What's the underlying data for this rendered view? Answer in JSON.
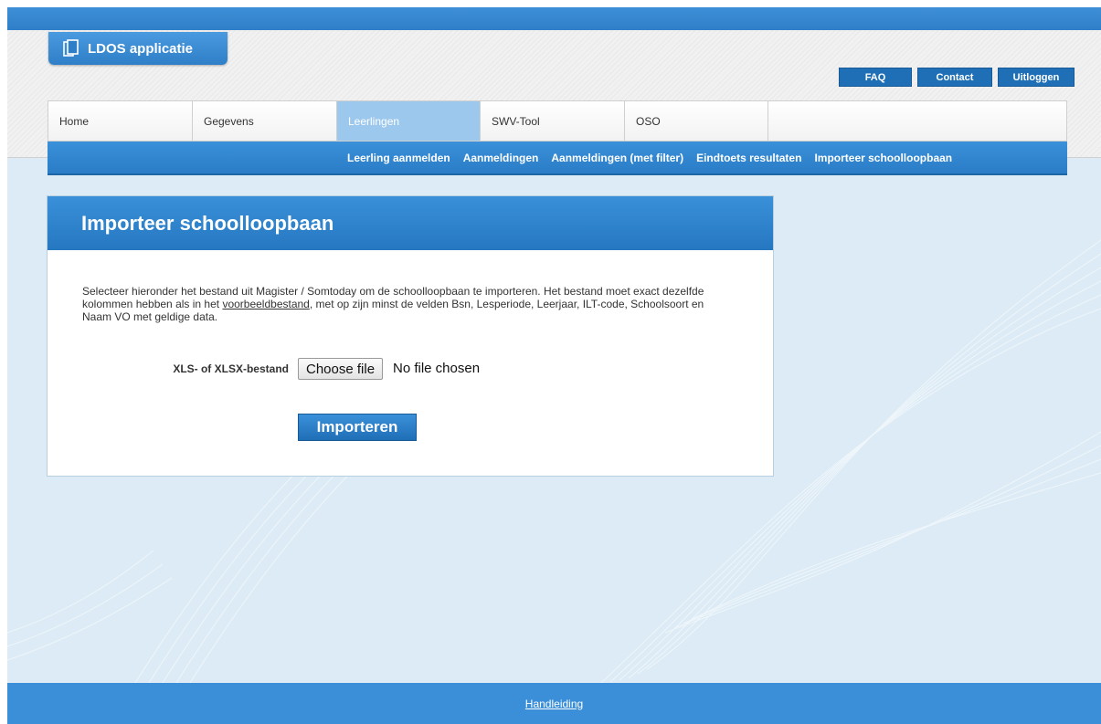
{
  "app": {
    "title": "LDOS applicatie"
  },
  "top_links": {
    "faq": "FAQ",
    "contact": "Contact",
    "logout": "Uitloggen"
  },
  "nav": {
    "tabs": [
      {
        "label": "Home"
      },
      {
        "label": "Gegevens"
      },
      {
        "label": "Leerlingen",
        "active": true
      },
      {
        "label": "SWV-Tool"
      },
      {
        "label": "OSO"
      }
    ]
  },
  "subnav": {
    "items": [
      {
        "label": "Leerling aanmelden"
      },
      {
        "label": "Aanmeldingen"
      },
      {
        "label": "Aanmeldingen (met filter)"
      },
      {
        "label": "Eindtoets resultaten"
      },
      {
        "label": "Importeer schoolloopbaan"
      }
    ]
  },
  "panel": {
    "title": "Importeer schoolloopbaan",
    "intro_before_link": "Selecteer hieronder het bestand uit Magister / Somtoday om de schoolloopbaan te importeren. Het bestand moet exact dezelfde kolommen hebben als in het ",
    "intro_link": "voorbeeldbestand",
    "intro_after_link": ", met op zijn minst de velden Bsn, Lesperiode, Leerjaar, ILT-code, Schoolsoort en Naam VO met geldige data.",
    "file_label": "XLS- of XLSX-bestand",
    "choose_button": "Choose file",
    "no_file": "No file chosen",
    "import_button": "Importeren"
  },
  "footer": {
    "link": "Handleiding"
  },
  "colors": {
    "primary": "#2f7fc8",
    "active_tab": "#9cc8ee",
    "background": "#dcebf5"
  }
}
